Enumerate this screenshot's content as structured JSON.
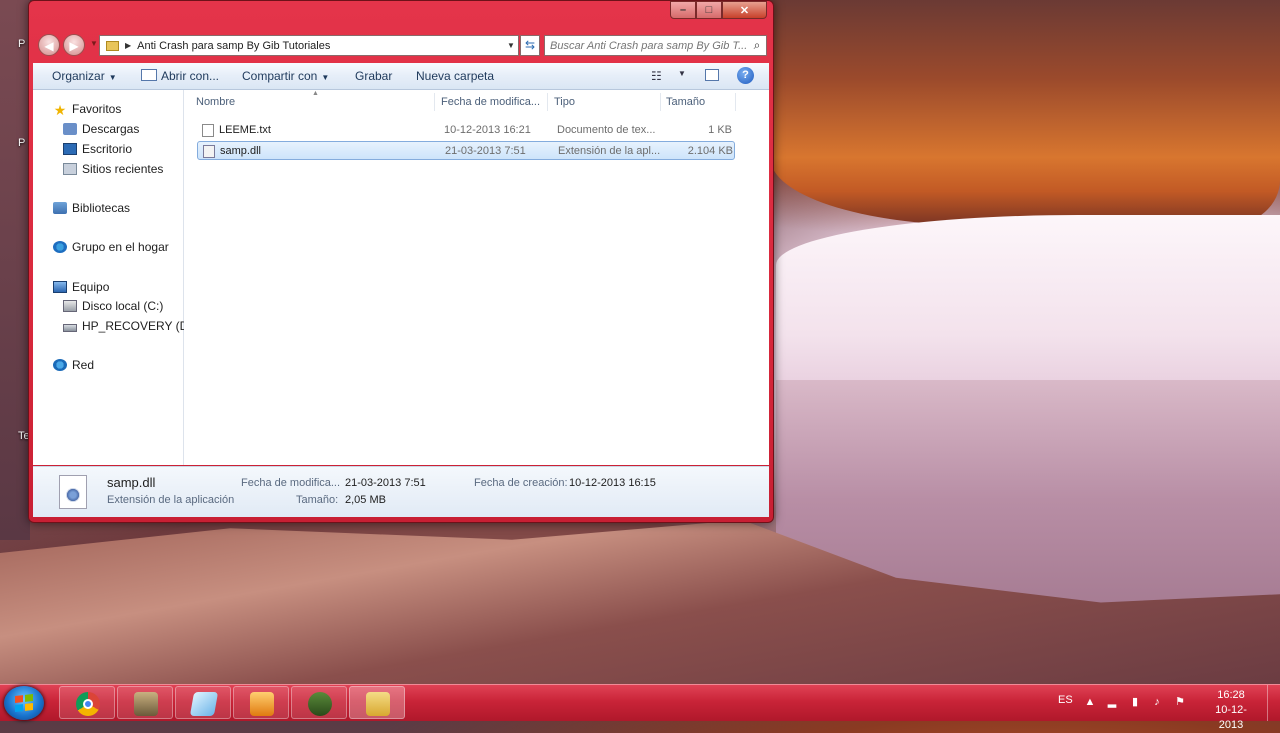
{
  "desktop": {
    "icon_fragments": [
      "P",
      "P",
      "Te"
    ]
  },
  "window": {
    "address_path": "Anti Crash para samp By Gib Tutoriales",
    "search_placeholder": "Buscar Anti Crash para samp By Gib T...",
    "caption": {
      "minimize": "–",
      "maximize": "□",
      "close": "✕"
    }
  },
  "toolbar": {
    "organize": "Organizar",
    "open_with": "Abrir con...",
    "share_with": "Compartir con",
    "burn": "Grabar",
    "new_folder": "Nueva carpeta"
  },
  "nav": {
    "favorites": "Favoritos",
    "downloads": "Descargas",
    "desktop": "Escritorio",
    "recent": "Sitios recientes",
    "libraries": "Bibliotecas",
    "homegroup": "Grupo en el hogar",
    "computer": "Equipo",
    "disk_c": "Disco local (C:)",
    "disk_d": "HP_RECOVERY (D:)",
    "network": "Red"
  },
  "columns": {
    "name": "Nombre",
    "date": "Fecha de modifica...",
    "type": "Tipo",
    "size": "Tamaño"
  },
  "files": [
    {
      "name": "LEEME.txt",
      "date": "10-12-2013 16:21",
      "type": "Documento de tex...",
      "size": "1 KB"
    },
    {
      "name": "samp.dll",
      "date": "21-03-2013 7:51",
      "type": "Extensión de la apl...",
      "size": "2.104 KB"
    }
  ],
  "details": {
    "filename": "samp.dll",
    "filetype": "Extensión de la aplicación",
    "modified_label": "Fecha de modifica...",
    "modified_value": "21-03-2013 7:51",
    "size_label": "Tamaño:",
    "size_value": "2,05 MB",
    "created_label": "Fecha de creación:",
    "created_value": "10-12-2013 16:15"
  },
  "taskbar": {
    "language": "ES",
    "time": "16:28",
    "date": "10-12-2013"
  }
}
